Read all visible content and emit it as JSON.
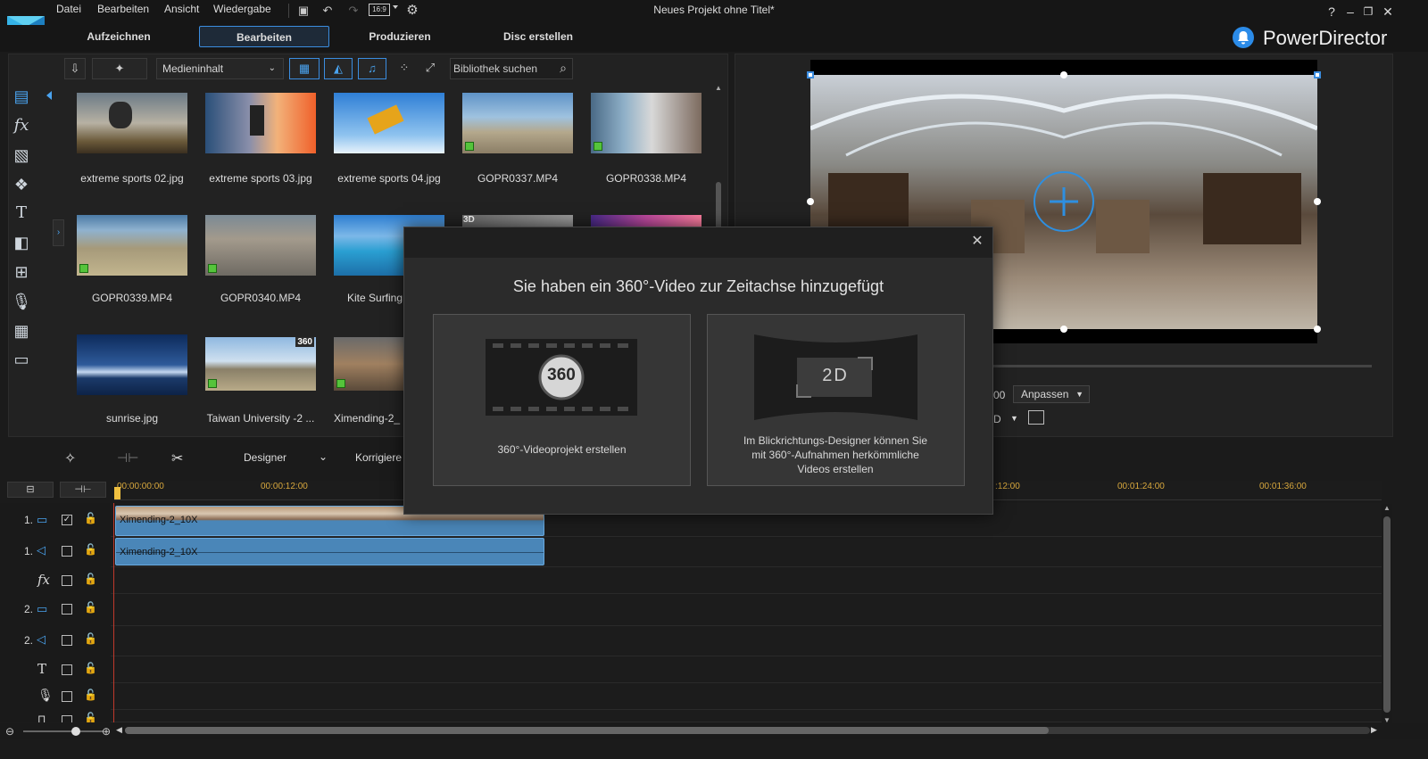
{
  "menu": {
    "file": "Datei",
    "edit": "Bearbeiten",
    "view": "Ansicht",
    "playback": "Wiedergabe"
  },
  "window": {
    "title": "Neues Projekt ohne Titel*",
    "aspect": "16:9",
    "help": "?"
  },
  "modes": {
    "capture": "Aufzeichnen",
    "edit": "Bearbeiten",
    "produce": "Produzieren",
    "disc": "Disc erstellen"
  },
  "brand": "PowerDirector",
  "library": {
    "media_select": "Medieninhalt",
    "search_placeholder": "Bibliothek suchen",
    "items": [
      {
        "name": "extreme sports 02.jpg"
      },
      {
        "name": "extreme sports 03.jpg"
      },
      {
        "name": "extreme sports 04.jpg"
      },
      {
        "name": "GOPR0337.MP4"
      },
      {
        "name": "GOPR0338.MP4"
      },
      {
        "name": "GOPR0339.MP4"
      },
      {
        "name": "GOPR0340.MP4"
      },
      {
        "name": "Kite Surfing"
      },
      {
        "name": "sunrise.jpg"
      },
      {
        "name": "Taiwan University -2 ..."
      },
      {
        "name": "Ximending-2_"
      }
    ],
    "badge_3d": "3D",
    "badge_360": "360"
  },
  "preview": {
    "fit_label": "Anpassen",
    "time_partial": "00",
    "mode_partial": "D"
  },
  "timeline_toolbar": {
    "designer": "Designer",
    "correct": "Korrigiere"
  },
  "ruler": [
    "00:00:00:00",
    "00:00:12:00",
    ":12:00",
    "00:01:24:00",
    "00:01:36:00"
  ],
  "tracks": [
    {
      "label": "1.",
      "clip": "Ximending-2_10X"
    },
    {
      "label": "1.",
      "clip": "Ximending-2_10X"
    },
    {
      "label": "",
      "clip": ""
    },
    {
      "label": "2.",
      "clip": ""
    },
    {
      "label": "2.",
      "clip": ""
    },
    {
      "label": "",
      "clip": ""
    },
    {
      "label": "",
      "clip": ""
    }
  ],
  "modal": {
    "title": "Sie haben ein 360°-Video zur Zeitachse hinzugefügt",
    "option1_icon": "360",
    "option1_text": "360°-Videoprojekt erstellen",
    "option2_icon": "2D",
    "option2_text": "Im Blickrichtungs-Designer können Sie mit 360°-Aufnahmen herkömmliche Videos erstellen"
  }
}
